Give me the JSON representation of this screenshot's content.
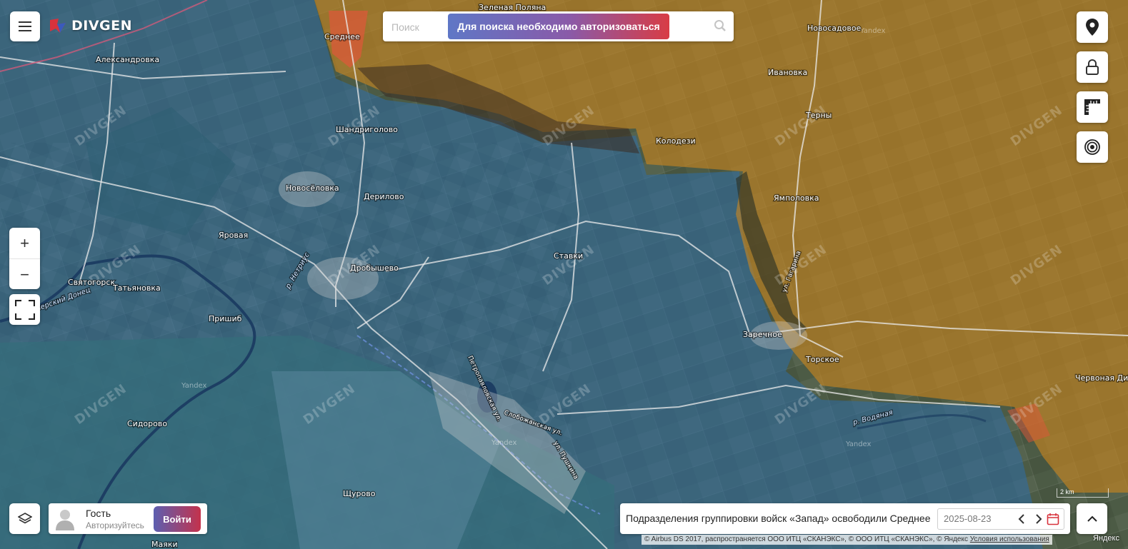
{
  "app": {
    "logo_text": "DIVGEN"
  },
  "search": {
    "placeholder": "Поиск",
    "auth_banner": "Для поиска необходимо авторизоваться"
  },
  "map": {
    "watermark": "DIVGEN",
    "provider_mark": "Yandex",
    "scale_label": "2 km",
    "zone_colors": {
      "ukraine_held": "#2d6ea8",
      "russia_held": "#c9861f",
      "contested": "#e0573a"
    },
    "places": [
      "Среднее",
      "Зеленая Поляна",
      "Новосадовое",
      "Александровка",
      "Ивановка",
      "Шандриголово",
      "Терны",
      "Колодези",
      "Новосёловка",
      "Дерилово",
      "Ямполовка",
      "Яровая",
      "Ставки",
      "Святогорск",
      "Татьяновка",
      "Дробышево",
      "Пришиб",
      "Заречное",
      "Торское",
      "Червоная Диброва",
      "Сидорово",
      "Щурово",
      "Маяки"
    ],
    "rivers": [
      "Северский Донец",
      "р. Нетриус",
      "р. Водяная"
    ],
    "roads": [
      "Петропавловская ул.",
      "Слобожанская ул.",
      "ул. Пушкина",
      "ул. Гагарина"
    ]
  },
  "controls": {
    "menu_icon": "hamburger-icon",
    "tools": [
      "location-pin-icon",
      "lock-icon",
      "ruler-icon",
      "target-icon"
    ],
    "zoom_in": "+",
    "zoom_out": "−"
  },
  "user": {
    "name": "Гость",
    "subtitle": "Авторизуйтесь",
    "login_label": "Войти"
  },
  "news": {
    "headline": "Подразделения группировки войск «Запад» освободили Среднее",
    "date": "2025-08-23"
  },
  "attribution": {
    "text": "© Airbus DS 2017, распространяется ООО ИТЦ «СКАНЭКС», © ООО ИТЦ «СКАНЭКС», © Яндекс",
    "link": "Условия использования",
    "yandex": "Яндекс"
  }
}
